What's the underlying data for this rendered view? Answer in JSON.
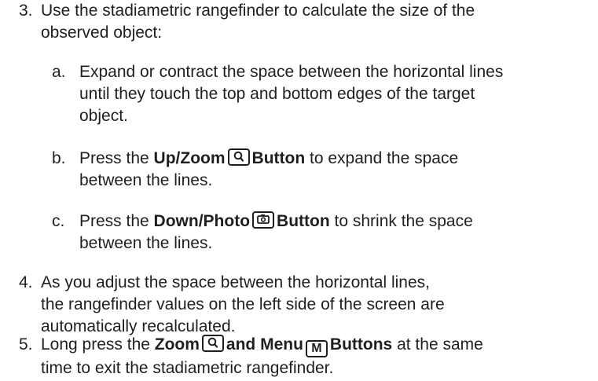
{
  "steps": [
    {
      "number": "3.",
      "lines": [
        "Use the stadiametric rangefinder to calculate the size of the",
        "observed object:"
      ],
      "substeps": [
        {
          "letter": "a.",
          "lines": [
            "Expand or contract the space between the horizontal lines",
            "until they touch the top and bottom edges of the target",
            "object."
          ]
        },
        {
          "letter": "b.",
          "pre": "Press the ",
          "bold": "Up/Zoom",
          "icon": "zoom-icon",
          "bold2": "Button",
          "post": " to expand the space",
          "line2": "between the lines."
        },
        {
          "letter": "c.",
          "pre": "Press the ",
          "bold": "Down/Photo",
          "icon": "camera-icon",
          "bold2": "Button",
          "post": " to shrink the space",
          "line2": "between the lines."
        }
      ]
    },
    {
      "number": "4.",
      "lines": [
        "As you adjust the space between the horizontal lines,",
        "the rangefinder values on the left side of the screen are",
        "automatically recalculated."
      ]
    },
    {
      "number": "5.",
      "pre": "Long press the ",
      "bold": "Zoom",
      "icon1": "zoom-icon",
      "bold_mid": "and Menu",
      "icon2_letter": "M",
      "bold2": "Buttons",
      "post": " at the same",
      "line2": "time to exit the stadiametric rangefinder."
    }
  ]
}
